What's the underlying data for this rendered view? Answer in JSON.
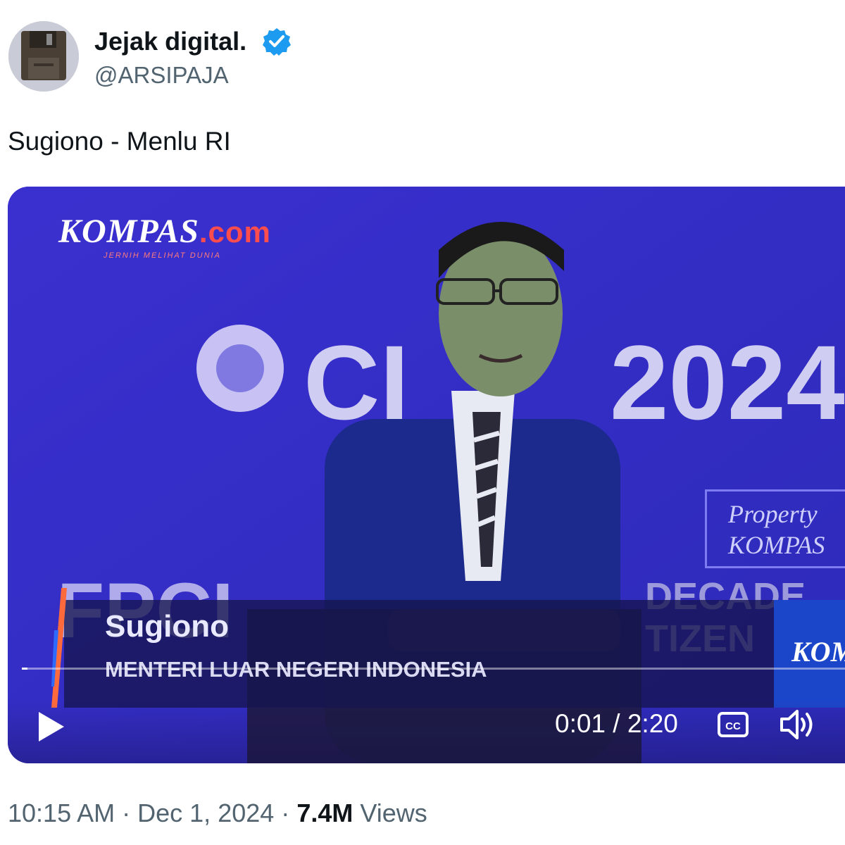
{
  "author": {
    "display_name": "Jejak digital.",
    "handle": "@ARSIPAJA",
    "avatar_icon": "floppy-disk-icon",
    "verified_icon": "verified-badge-icon"
  },
  "tweet": {
    "text": "Sugiono - Menlu RI"
  },
  "video": {
    "watermark": {
      "brand": "KOMPAS",
      "suffix": ".com",
      "tagline": "JERNIH MELIHAT DUNIA"
    },
    "background_text": {
      "event": "CI  P2024",
      "left_fragment": "FPCI",
      "right_fragment_1": "DECADE",
      "right_fragment_2": "TIZEN"
    },
    "property_badge": {
      "line1": "Property",
      "line2": "KOMPAS"
    },
    "lower_third": {
      "name": "Sugiono",
      "title": "MENTERI LUAR NEGERI INDONESIA",
      "right_logo": "KOM"
    },
    "player": {
      "play_icon": "play-icon",
      "current_time": "0:01",
      "duration": "2:20",
      "time_display": "0:01 / 2:20",
      "progress_fraction": 0.007,
      "cc_icon": "closed-captions-icon",
      "volume_icon": "volume-icon"
    },
    "colors": {
      "backdrop": "#3b2fc8",
      "lower_third": "#16145a",
      "accent": "#1c46c9"
    }
  },
  "meta": {
    "time": "10:15 AM",
    "separator": "·",
    "date": "Dec 1, 2024",
    "views_count": "7.4M",
    "views_label": "Views"
  }
}
